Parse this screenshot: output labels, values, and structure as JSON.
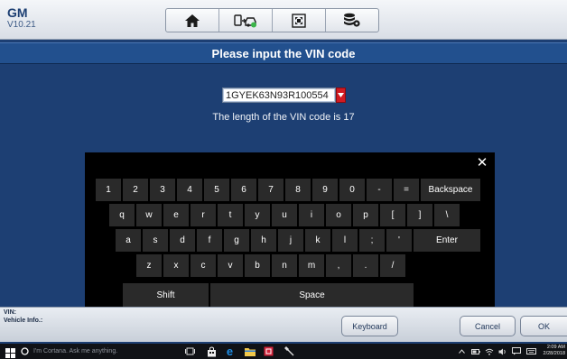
{
  "header": {
    "brand": "GM",
    "version": "V10.21",
    "toolbar": [
      {
        "icon": "home-icon"
      },
      {
        "icon": "vehicle-swap-icon"
      },
      {
        "icon": "fullscreen-icon"
      },
      {
        "icon": "data-settings-icon"
      }
    ]
  },
  "title": "Please input the VIN code",
  "vin": {
    "value": "1GYEK63N93R100554",
    "length_text": "The length of the VIN code is 17"
  },
  "keyboard": {
    "close": "✕",
    "row1": [
      "1",
      "2",
      "3",
      "4",
      "5",
      "6",
      "7",
      "8",
      "9",
      "0",
      "-",
      "="
    ],
    "backspace": "Backspace",
    "row2": [
      "q",
      "w",
      "e",
      "r",
      "t",
      "y",
      "u",
      "i",
      "o",
      "p",
      "[",
      "]",
      "\\"
    ],
    "row3": [
      "a",
      "s",
      "d",
      "f",
      "g",
      "h",
      "j",
      "k",
      "l",
      ";",
      "'"
    ],
    "enter": "Enter",
    "row4": [
      "z",
      "x",
      "c",
      "v",
      "b",
      "n",
      "m",
      ",",
      ".",
      "/"
    ],
    "shift": "Shift",
    "space": "Space"
  },
  "footer": {
    "vin_label": "VIN:",
    "vehicle_info_label": "Vehicle Info.:",
    "keyboard_button": "Keyboard",
    "cancel_button": "Cancel",
    "ok_button": "OK"
  },
  "taskbar": {
    "search_placeholder": "I'm Cortana. Ask me anything.",
    "time": "2:09 AM",
    "date": "2/28/2018"
  },
  "colors": {
    "background": "#1d3f73",
    "title_bar": "#22508e",
    "dropdown_accent": "#d11a22",
    "keyboard_bg": "#000000",
    "key_bg": "#2a2a2a"
  }
}
